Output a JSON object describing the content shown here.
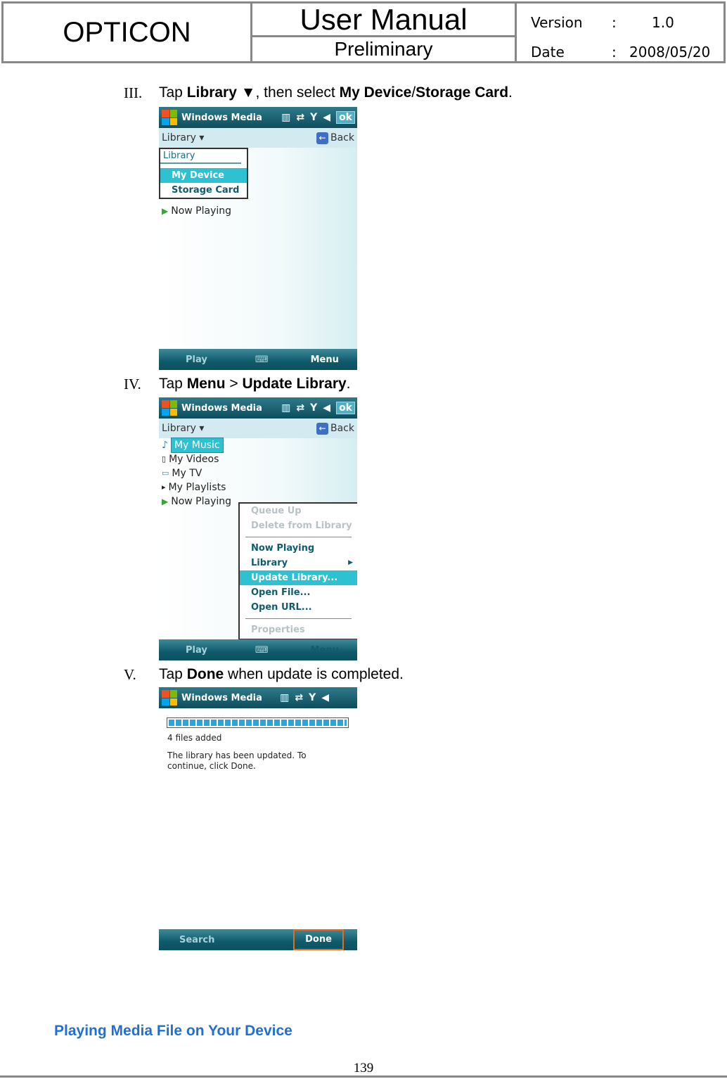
{
  "header": {
    "company": "OPTICON",
    "title": "User Manual",
    "subtitle": "Preliminary",
    "version_label": "Version",
    "version": "1.0",
    "date_label": "Date",
    "date": "2008/05/20",
    "sep": ":"
  },
  "steps": [
    {
      "num": "III.",
      "t1": "Tap ",
      "b1": "Library ▼",
      "t2": ", then select ",
      "b2": "My Device",
      "t3": "/",
      "b3": "Storage Card",
      "t4": "."
    },
    {
      "num": "IV.",
      "t1": "Tap ",
      "b1": "Menu",
      "t2": " > ",
      "b2": "Update Library",
      "t3": "."
    },
    {
      "num": "V.",
      "t1": "Tap ",
      "b1": "Done",
      "t2": " when update is completed."
    }
  ],
  "phone": {
    "app_title": "Windows Media",
    "ok": "ok",
    "library": "Library ▾",
    "back": "Back",
    "play": "Play",
    "menu": "Menu",
    "search": "Search",
    "done": "Done"
  },
  "screen1": {
    "popup_header": "Library",
    "items": [
      "My Device",
      "Storage Card"
    ],
    "now_playing": "Now Playing"
  },
  "screen2": {
    "items": [
      "My Music",
      "My Videos",
      "My TV",
      "My Playlists",
      "Now Playing"
    ],
    "menu": {
      "disabled_top": [
        "Queue Up",
        "Delete from Library"
      ],
      "items": [
        "Now Playing",
        "Library",
        "Update Library...",
        "Open File...",
        "Open URL..."
      ],
      "disabled_bottom": [
        "Properties"
      ]
    }
  },
  "screen3": {
    "progress": 1.0,
    "files_added": "4 files added",
    "message": "The library has been updated. To continue, click Done."
  },
  "footer": {
    "section": "Playing Media File on Your Device",
    "page": "139"
  },
  "colors": {
    "accent": "#2dc1d2",
    "footer_link": "#1f6fd6",
    "done_highlight": "#e86a1c"
  }
}
